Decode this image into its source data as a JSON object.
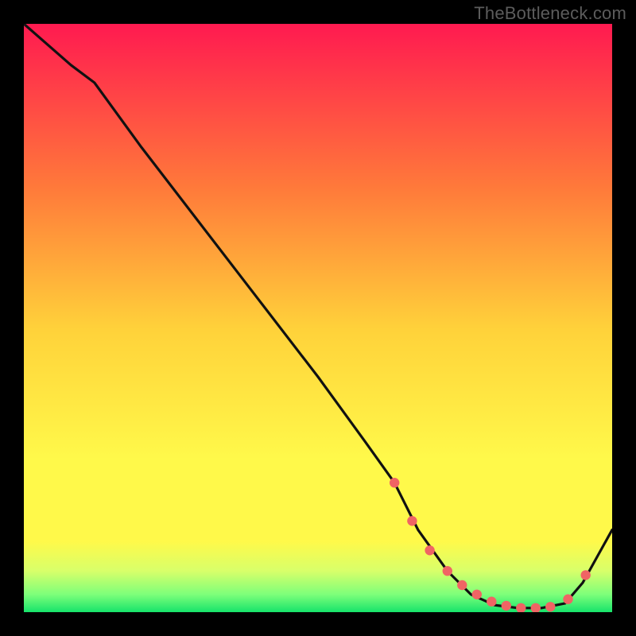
{
  "watermark": "TheBottleneck.com",
  "colors": {
    "bg": "#000000",
    "grad_top": "#ff1a50",
    "grad_mid1": "#ff7a3a",
    "grad_mid2": "#ffd23a",
    "grad_mid3": "#fff94a",
    "grad_low1": "#d8ff6a",
    "grad_low2": "#7dff7a",
    "grad_bottom": "#17e36b",
    "curve": "#111111",
    "marker": "#f06464"
  },
  "chart_data": {
    "type": "line",
    "title": "",
    "xlabel": "",
    "ylabel": "",
    "xlim": [
      0,
      100
    ],
    "ylim": [
      0,
      100
    ],
    "series": [
      {
        "name": "curve",
        "x": [
          0,
          8,
          12,
          20,
          30,
          40,
          50,
          58,
          63,
          67,
          72,
          76,
          80,
          84,
          88,
          92,
          95,
          100
        ],
        "y": [
          100,
          93,
          90,
          79,
          66,
          53,
          40,
          29,
          22,
          14,
          7,
          3,
          1.2,
          0.7,
          0.7,
          1.5,
          5,
          14
        ]
      }
    ],
    "markers": {
      "name": "dots",
      "x": [
        63,
        66,
        69,
        72,
        74.5,
        77,
        79.5,
        82,
        84.5,
        87,
        89.5,
        92.5,
        95.5
      ],
      "y": [
        22,
        15.5,
        10.5,
        7,
        4.6,
        3,
        1.8,
        1.1,
        0.7,
        0.7,
        0.9,
        2.2,
        6.3
      ]
    }
  }
}
